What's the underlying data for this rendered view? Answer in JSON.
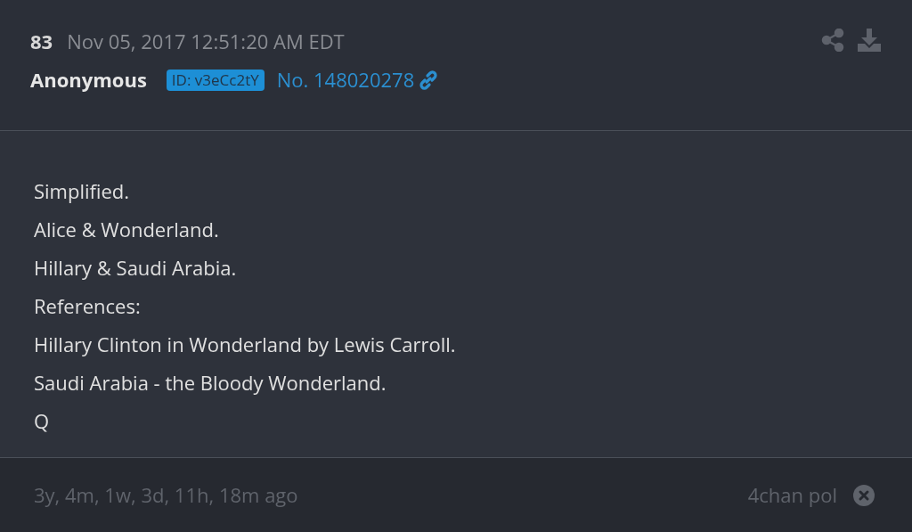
{
  "post": {
    "number": "83",
    "date": "Nov 05, 2017 12:51:20 AM EDT",
    "author": "Anonymous",
    "id_badge": "ID: v3eCc2tY",
    "post_link": "No. 148020278"
  },
  "body_lines": [
    "Simplified.",
    "Alice & Wonderland.",
    "Hillary & Saudi Arabia.",
    "References:",
    "Hillary Clinton in Wonderland by Lewis Carroll.",
    "Saudi Arabia - the Bloody Wonderland.",
    "Q"
  ],
  "footer": {
    "age": "3y, 4m, 1w, 3d, 11h, 18m ago",
    "source": "4chan pol"
  }
}
